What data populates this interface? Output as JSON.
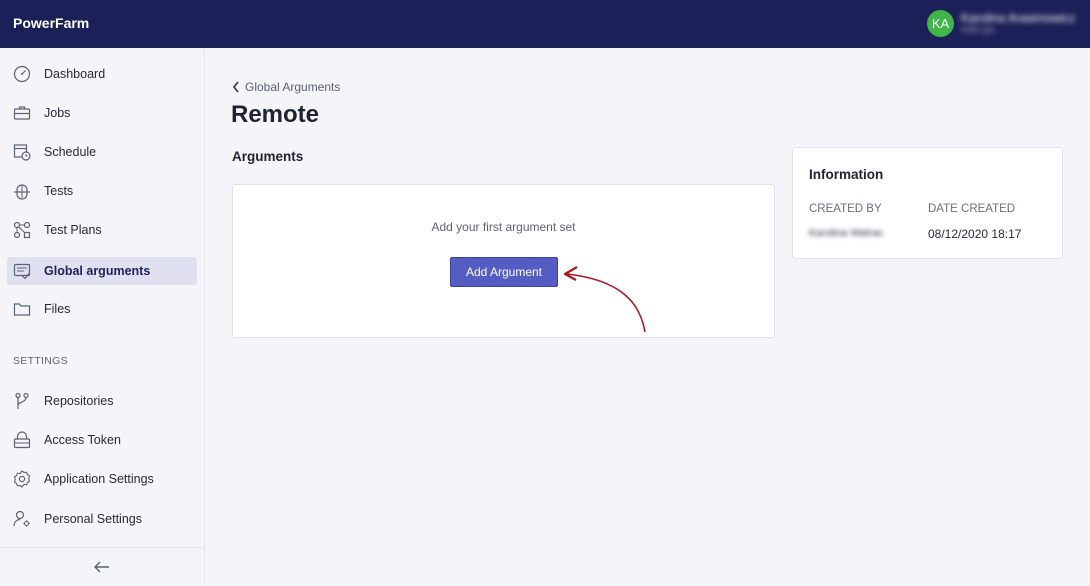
{
  "header": {
    "brand": "PowerFarm",
    "user_initials": "KA",
    "user_name": "Karolina Arasimowicz",
    "user_subtitle": "HIRI QA"
  },
  "sidebar": {
    "items": [
      {
        "label": "Dashboard",
        "icon": "dashboard-gauge-icon"
      },
      {
        "label": "Jobs",
        "icon": "briefcase-icon"
      },
      {
        "label": "Schedule",
        "icon": "calendar-clock-icon"
      },
      {
        "label": "Tests",
        "icon": "bug-icon"
      },
      {
        "label": "Test Plans",
        "icon": "test-plans-icon"
      },
      {
        "label": "Global arguments",
        "icon": "global-arguments-icon",
        "active": true
      },
      {
        "label": "Files",
        "icon": "folder-icon"
      }
    ],
    "settings_heading": "SETTINGS",
    "settings_items": [
      {
        "label": "Repositories",
        "icon": "git-branch-icon"
      },
      {
        "label": "Access Token",
        "icon": "lock-icon"
      },
      {
        "label": "Application Settings",
        "icon": "gear-icon"
      },
      {
        "label": "Personal Settings",
        "icon": "user-settings-icon"
      }
    ],
    "collapse_icon": "arrow-left-icon"
  },
  "main": {
    "breadcrumb": "Global Arguments",
    "title": "Remote",
    "section_title": "Arguments",
    "empty_text": "Add your first argument set",
    "add_button": "Add Argument"
  },
  "info": {
    "title": "Information",
    "created_by_label": "CREATED BY",
    "created_by_value": "Karolina Watrac",
    "date_created_label": "DATE CREATED",
    "date_created_value": "08/12/2020 18:17"
  },
  "colors": {
    "topbar": "#1c2058",
    "accent_button": "#555cc2",
    "avatar": "#3fb54a",
    "annotation_arrow": "#a31b24"
  }
}
